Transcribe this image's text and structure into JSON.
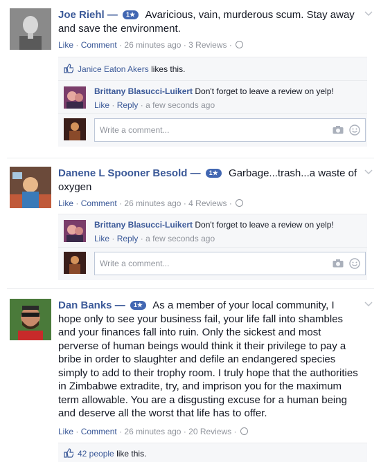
{
  "posts": [
    {
      "author": "Joe Riehl",
      "dash": "—",
      "badge": "1★",
      "text": "Avaricious, vain, murderous scum. Stay away and save the environment.",
      "like": "Like",
      "comment": "Comment",
      "time": "26 minutes ago",
      "reviews": "3 Reviews",
      "dot": "·",
      "likes_name": "Janice Eaton Akers",
      "likes_suffix": "likes this.",
      "reply": {
        "author": "Brittany Blasucci-Luikert",
        "text": "Don't forget to leave a review on yelp!",
        "like": "Like",
        "reply": "Reply",
        "time": "a few seconds ago"
      },
      "compose_placeholder": "Write a comment..."
    },
    {
      "author": "Danene L Spooner Besold",
      "dash": "—",
      "badge": "1★",
      "text": "Garbage...trash...a waste of oxygen",
      "like": "Like",
      "comment": "Comment",
      "time": "26 minutes ago",
      "reviews": "4 Reviews",
      "dot": "·",
      "reply": {
        "author": "Brittany Blasucci-Luikert",
        "text": "Don't forget to leave a review on yelp!",
        "like": "Like",
        "reply": "Reply",
        "time": "a few seconds ago"
      },
      "compose_placeholder": "Write a comment..."
    },
    {
      "author": "Dan Banks",
      "dash": "—",
      "badge": "1★",
      "text": "As a member of your local community, I hope only to see your business fail, your life fall into shambles and your finances fall into ruin. Only the sickest and most perverse of human beings would think it their privilege to pay a bribe in order to slaughter and defile an endangered species simply to add to their trophy room. I truly hope that the authorities in Zimbabwe extradite, try, and imprison you for the maximum term allowable. You are a disgusting excuse for a human being and deserve all the worst that life has to offer.",
      "like": "Like",
      "comment": "Comment",
      "time": "26 minutes ago",
      "reviews": "20 Reviews",
      "dot": "·",
      "likes_name": "42 people",
      "likes_suffix": "like this."
    }
  ],
  "colors": {
    "link": "#3b5998",
    "badge": "#4267b2",
    "muted": "#90949c",
    "panel": "#f6f7f9"
  }
}
